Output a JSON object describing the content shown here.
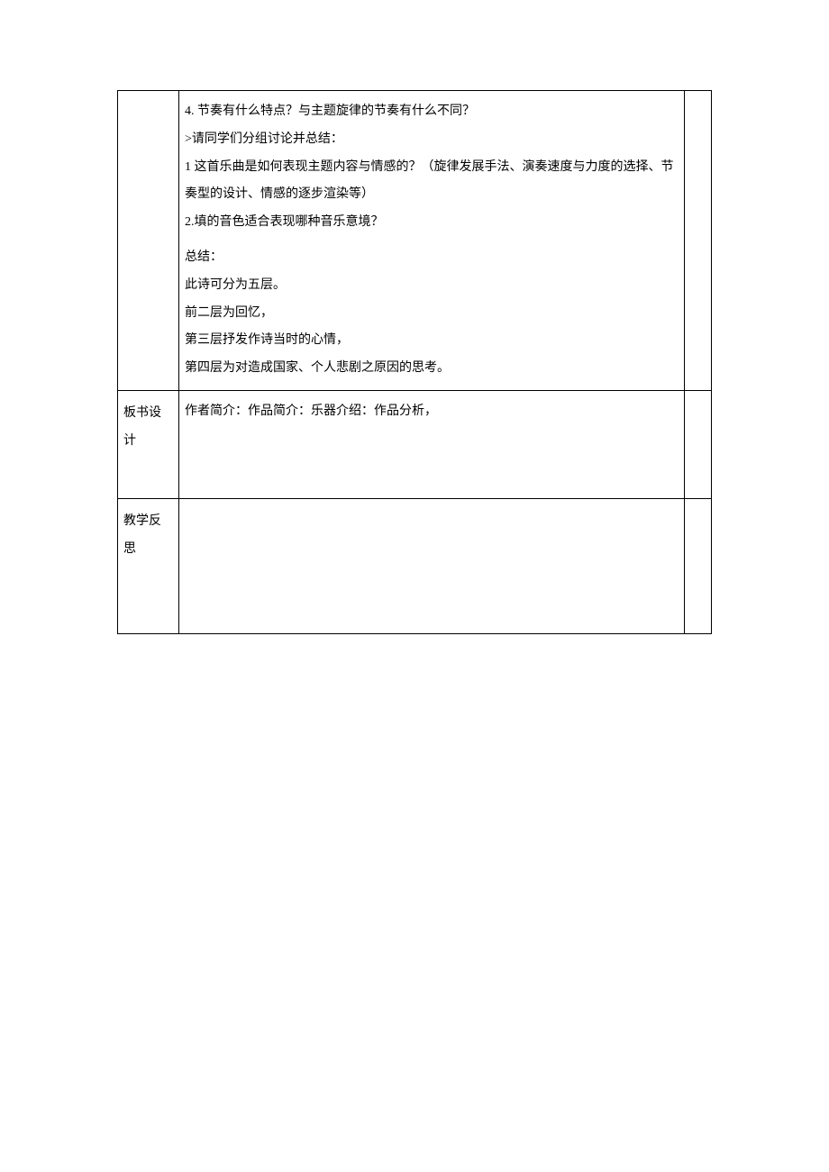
{
  "rows": [
    {
      "label": "",
      "lines": [
        "4. 节奏有什么特点？与主题旋律的节奏有什么不同？",
        ">请同学们分组讨论并总结：",
        "1 这首乐曲是如何表现主题内容与情感的？（旋律发展手法、演奏速度与力度的选择、节奏型的设计、情感的逐步渲染等）",
        "2.填的音色适合表现哪种音乐意境？",
        "",
        "总结：",
        "此诗可分为五层。",
        "前二层为回忆，",
        "第三层抒发作诗当时的心情，",
        "第四层为对造成国家、个人悲剧之原因的思考。"
      ]
    },
    {
      "label": "板书设计",
      "lines": [
        "作者简介：作品简介：乐器介绍：作品分析，"
      ]
    },
    {
      "label": "教学反思",
      "lines": []
    }
  ]
}
